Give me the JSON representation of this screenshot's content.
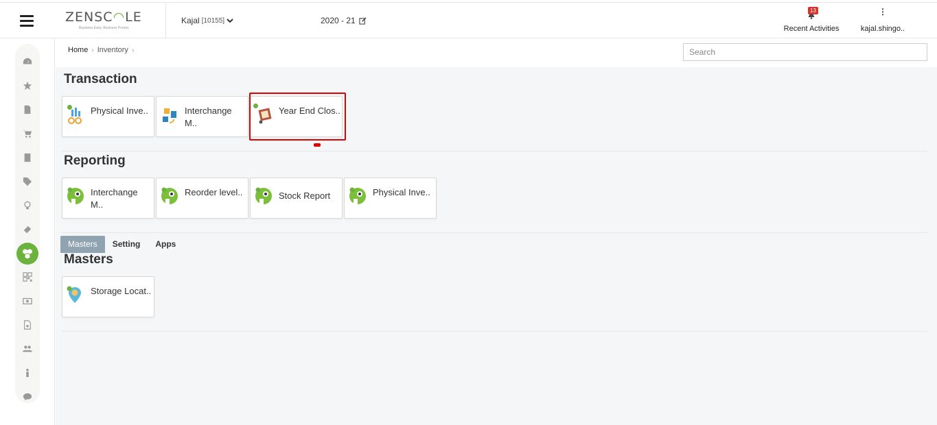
{
  "header": {
    "logo_text_pre": "ZENSC",
    "logo_text_mid": "⌂",
    "logo_text_post": "LE",
    "logo_tagline": "Business Easy. Business Pocket.",
    "user_name": "Kajal",
    "user_id": "[10155]",
    "financial_year": "2020 - 21",
    "recent_count": "13",
    "recent_label": "Recent Activities",
    "account_label": "kajal.shingo.."
  },
  "breadcrumb": {
    "home": "Home",
    "current": "Inventory"
  },
  "search": {
    "placeholder": "Search"
  },
  "sections": {
    "transaction": {
      "title": "Transaction",
      "tiles": [
        "Physical Inve..",
        "Interchange M..",
        "Year End Clos.."
      ]
    },
    "reporting": {
      "title": "Reporting",
      "tiles": [
        "Interchange M..",
        "Reorder level..",
        "Stock Report",
        "Physical Inve.."
      ]
    },
    "masters": {
      "title": "Masters",
      "tiles": [
        "Storage Locat.."
      ]
    }
  },
  "tabs": [
    "Masters",
    "Setting",
    "Apps"
  ],
  "colors": {
    "accent": "#6cb33e",
    "highlight": "#e00000",
    "active_tab": "#8fa4b0"
  },
  "sidebar_icons": [
    "dashboard-icon",
    "star-icon",
    "document-icon",
    "cart-icon",
    "ledger-icon",
    "tag-icon",
    "bulb-icon",
    "ticket-icon",
    "inventory-icon",
    "qrcode-icon",
    "money-icon",
    "certificate-icon",
    "users-icon",
    "person-icon",
    "chat-icon"
  ]
}
